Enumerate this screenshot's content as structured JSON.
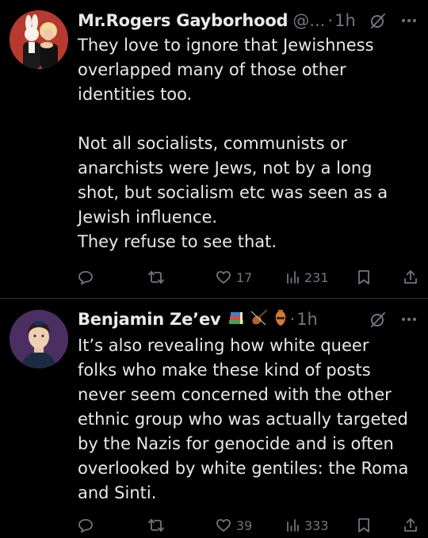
{
  "tweets": [
    {
      "display_name": "Mr.Rogers Gayborhood",
      "handle": "@...",
      "separator": "·",
      "time": "1h",
      "text": "They love to ignore that Jewishness\noverlapped many of those other\nidentities too.\n\nNot all socialists, communists or\nanarchists were Jews, not by a long\nshot, but socialism etc was seen as a\nJewish influence.\nThey refuse to see that.",
      "replies": "",
      "retweets": "",
      "likes": "17",
      "views": "231"
    },
    {
      "display_name": "Benjamin Ze’ev",
      "name_emoji": [
        "books-emoji",
        "violin-emoji",
        "amphora-emoji"
      ],
      "separator": "·",
      "time": "1h",
      "text": "It’s also revealing how white queer\nfolks who make these kind of posts\nnever seem concerned with the other\nethnic group who was actually targeted\nby the Nazis for genocide and is often\noverlooked by white gentiles: the Roma\nand Sinti.",
      "replies": "",
      "retweets": "",
      "likes": "39",
      "views": "333"
    }
  ],
  "colors": {
    "background": "#000000",
    "text": "#e7e9ea",
    "secondary": "#71767b",
    "divider": "#2f3336"
  },
  "icons": [
    "reply-icon",
    "retweet-icon",
    "like-icon",
    "views-icon",
    "bookmark-icon",
    "share-icon",
    "grok-icon",
    "more-icon"
  ]
}
